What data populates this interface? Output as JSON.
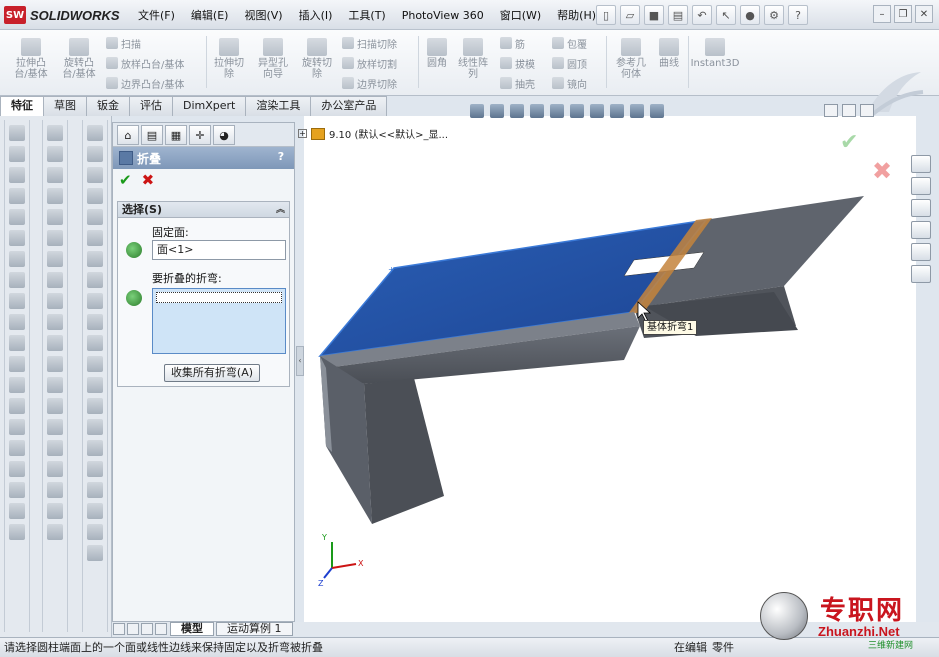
{
  "app": {
    "logo_box": "SW",
    "logo_text": "SOLIDWORKS"
  },
  "menu": [
    "文件(F)",
    "编辑(E)",
    "视图(V)",
    "插入(I)",
    "工具(T)",
    "PhotoView 360",
    "窗口(W)",
    "帮助(H)"
  ],
  "ribbon": {
    "big": [
      {
        "label": "拉伸凸\n台/基体"
      },
      {
        "label": "旋转凸\n台/基体"
      },
      {
        "label": "拉伸切\n除"
      },
      {
        "label": "异型孔\n向导"
      },
      {
        "label": "旋转切\n除"
      },
      {
        "label": "圆角"
      },
      {
        "label": "线性阵\n列"
      },
      {
        "label": "参考几\n何体"
      },
      {
        "label": "曲线"
      },
      {
        "label": "Instant3D"
      }
    ],
    "small": {
      "sweep": "扫描",
      "loft": "放样凸台/基体",
      "boundary": "边界凸台/基体",
      "sweep_cut": "扫描切除",
      "loft_cut": "放样切割",
      "boundary_cut": "边界切除",
      "rib": "筋",
      "draft": "拔模",
      "shell": "抽壳",
      "wrap": "包覆",
      "dome": "圆顶",
      "mirror": "镜向"
    }
  },
  "tabs": [
    "特征",
    "草图",
    "钣金",
    "评估",
    "DimXpert",
    "渲染工具",
    "办公室产品"
  ],
  "property_manager": {
    "title": "折叠",
    "help": "?",
    "ok": "✔",
    "cancel": "✖",
    "group_title": "选择(S)",
    "fixed_face_label": "固定面:",
    "fixed_face_value": "面<1>",
    "bends_label": "要折叠的折弯:",
    "collect_button": "收集所有折弯(A)"
  },
  "feature_tree": {
    "expander": "+",
    "text": "9.10  (默认<<默认>_显..."
  },
  "tooltip": "基体折弯1",
  "axes": {
    "x": "X",
    "y": "Y",
    "z": "Z"
  },
  "bottom_tabs": [
    "模型",
    "运动算例 1"
  ],
  "status": {
    "message": "请选择圆柱端面上的一个面或线性边线来保持固定以及折弯被折叠",
    "editing": "在编辑",
    "doc_type": "零件"
  },
  "watermark": {
    "cn": "专职网",
    "en": "Zhuanzhi.Net",
    "green": "三维新建网"
  },
  "colors": {
    "sheet_top_selected": "#1f4fa3",
    "sheet_body": "#5a5f68",
    "bend_highlight": "#c4843c"
  }
}
